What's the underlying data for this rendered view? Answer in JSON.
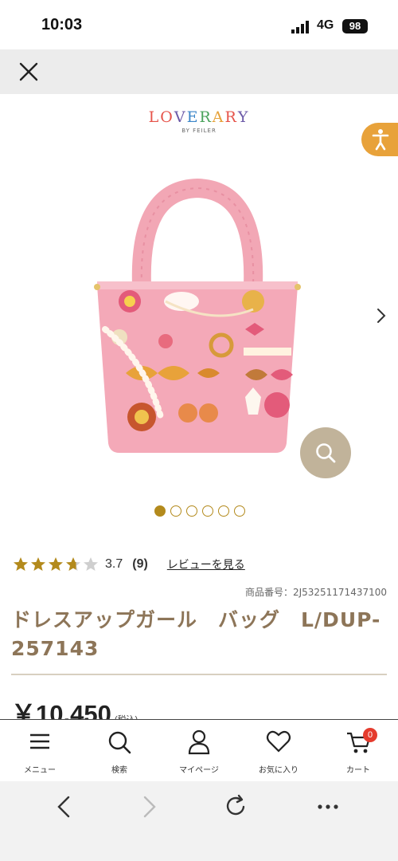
{
  "status_bar": {
    "time": "10:03",
    "network": "4G",
    "battery": "98"
  },
  "brand": {
    "logo_letters": [
      "L",
      "O",
      "V",
      "E",
      "R",
      "A",
      "R",
      "Y"
    ],
    "logo_colors": [
      "#e6534a",
      "#e6534a",
      "#6c5aa8",
      "#3b86c9",
      "#4aa35b",
      "#e6a23a",
      "#e6534a",
      "#6c5aa8"
    ],
    "sub": "BY FEILER"
  },
  "carousel": {
    "dots": 6,
    "active_index": 0
  },
  "rating": {
    "value": 3.7,
    "stars_max": 5,
    "score_text": "3.7",
    "count_text": "(9)",
    "review_link": "レビューを見る"
  },
  "product": {
    "item_number": "商品番号：2J53251171437100",
    "title": "ドレスアップガール　バッグ　L/DUP-257143",
    "price": "￥10,450",
    "tax_note": "(税込)"
  },
  "bottom_nav": [
    {
      "label": "メニュー",
      "icon": "hamburger-menu-icon"
    },
    {
      "label": "検索",
      "icon": "search-icon"
    },
    {
      "label": "マイページ",
      "icon": "user-icon"
    },
    {
      "label": "お気に入り",
      "icon": "heart-icon"
    },
    {
      "label": "カート",
      "icon": "cart-icon",
      "badge": "0"
    }
  ],
  "colors": {
    "accent_gold": "#b38a1c",
    "title_brown": "#8d7558",
    "a11y_orange": "#e8a23a",
    "zoom_beige": "#c1b39a",
    "badge_red": "#e53c2e"
  }
}
